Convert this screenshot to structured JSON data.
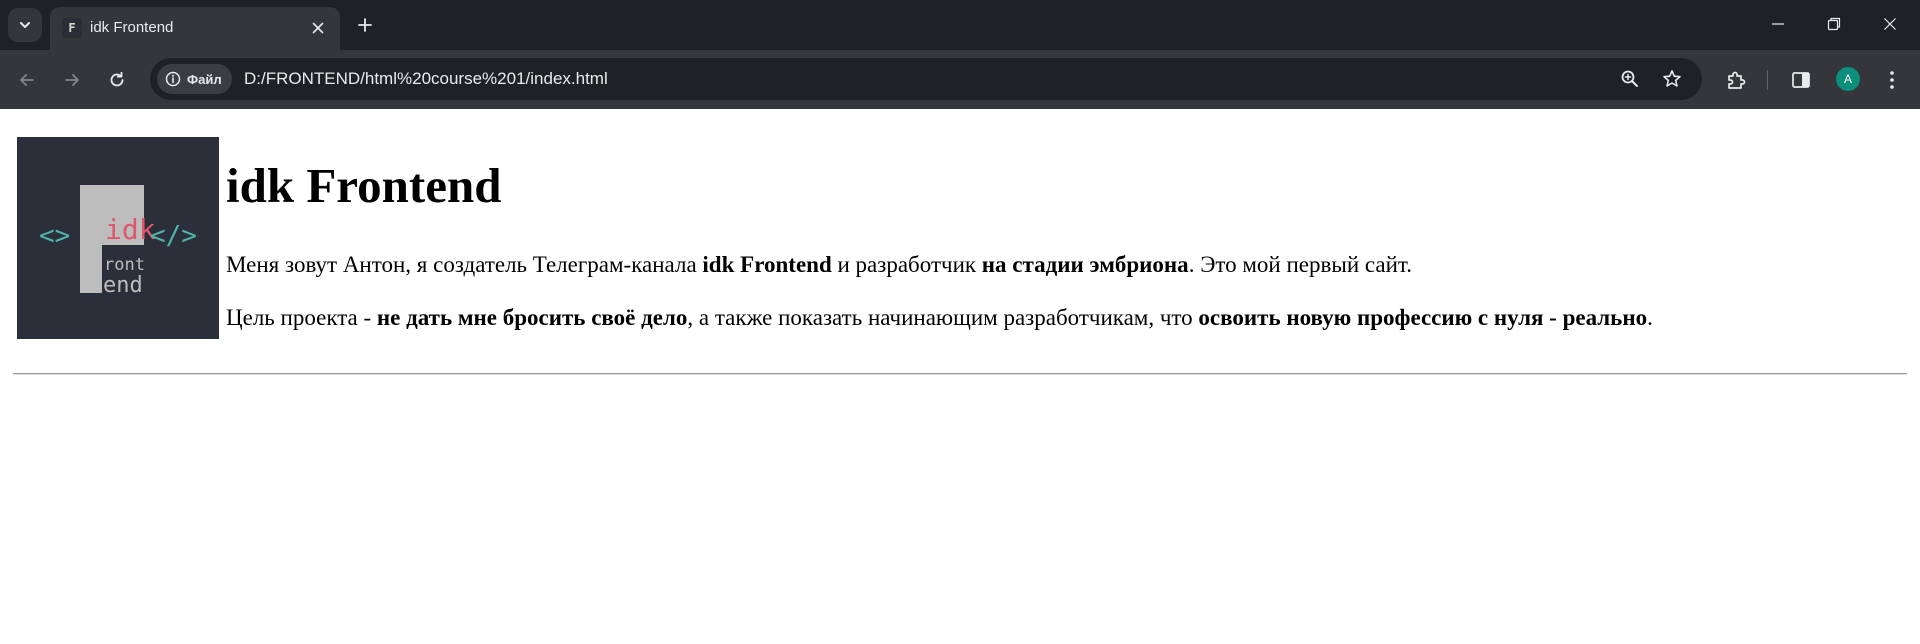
{
  "browser": {
    "tab": {
      "title": "idk Frontend",
      "favicon_letter": "F"
    },
    "omnibox": {
      "site_info_label": "Файл",
      "url": "D:/FRONTEND/html%20course%201/index.html"
    },
    "profile_initial": "A",
    "colors": {
      "frame": "#202124",
      "toolbar": "#35363a",
      "avatar": "#0b8f7b"
    }
  },
  "page": {
    "logo": {
      "big_letter": "F",
      "word_top": "idk",
      "word_mid": "ront",
      "word_bottom": "end",
      "left_symbol": "<>",
      "right_symbol": "</>",
      "colors": {
        "bg": "#2a2f3a",
        "letter": "#bdbdbd",
        "accent": "#e0566a",
        "symbols": "#4fb3a9"
      }
    },
    "title": "idk Frontend",
    "intro": {
      "p1": "Меня зовут Антон, я создатель Телеграм-канала ",
      "b1": "idk Frontend",
      "p2": " и разработчик ",
      "b2": "на стадии эмбриона",
      "p3": ". Это мой первый сайт."
    },
    "goal": {
      "p1": "Цель проекта - ",
      "b1": "не дать мне бросить своё дело",
      "p2": ", а также показать начинающим разработчикам, что ",
      "b2": "освоить новую профессию с нуля - реально",
      "p3": "."
    }
  }
}
